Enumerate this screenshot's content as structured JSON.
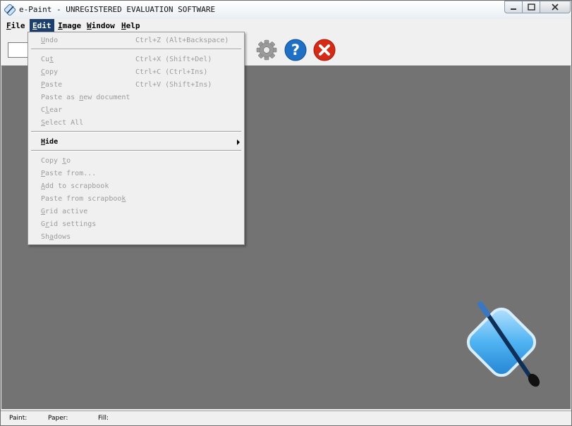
{
  "window": {
    "title": "e-Paint - UNREGISTERED EVALUATION SOFTWARE"
  },
  "menubar": {
    "items": [
      {
        "label": "File",
        "accel": "F",
        "rest": "ile"
      },
      {
        "label": "Edit",
        "accel": "E",
        "rest": "dit"
      },
      {
        "label": "Image",
        "accel": "I",
        "rest": "mage"
      },
      {
        "label": "Window",
        "accel": "W",
        "rest": "indow"
      },
      {
        "label": "Help",
        "accel": "H",
        "rest": "elp"
      }
    ]
  },
  "edit_menu": {
    "undo": {
      "pre": "",
      "accel": "U",
      "post": "ndo",
      "shortcut": "Ctrl+Z (Alt+Backspace)"
    },
    "cut": {
      "pre": "Cu",
      "accel": "t",
      "post": "",
      "shortcut": "Ctrl+X (Shift+Del)"
    },
    "copy": {
      "pre": "",
      "accel": "C",
      "post": "opy",
      "shortcut": "Ctrl+C (Ctrl+Ins)"
    },
    "paste": {
      "pre": "",
      "accel": "P",
      "post": "aste",
      "shortcut": "Ctrl+V (Shift+Ins)"
    },
    "paste_new": {
      "pre": "Paste as ",
      "accel": "n",
      "post": "ew document"
    },
    "clear": {
      "pre": "C",
      "accel": "l",
      "post": "ear"
    },
    "select_all": {
      "pre": "",
      "accel": "S",
      "post": "elect All"
    },
    "hide": {
      "pre": "",
      "accel": "H",
      "post": "ide"
    },
    "copy_to": {
      "pre": "Copy ",
      "accel": "t",
      "post": "o"
    },
    "paste_from": {
      "pre": "",
      "accel": "P",
      "post": "aste from..."
    },
    "add_scrapbook": {
      "pre": "",
      "accel": "A",
      "post": "dd to scrapbook"
    },
    "paste_scrapbook": {
      "pre": "Paste from scrapboo",
      "accel": "k",
      "post": ""
    },
    "grid_active": {
      "pre": "",
      "accel": "G",
      "post": "rid active"
    },
    "grid_settings": {
      "pre": "G",
      "accel": "r",
      "post": "id settings"
    },
    "shadows": {
      "pre": "Sh",
      "accel": "a",
      "post": "dows"
    }
  },
  "toolbar": {
    "icons": [
      "gear-icon",
      "help-icon",
      "close-icon"
    ]
  },
  "status": {
    "paint": "Paint:",
    "paper": "Paper:",
    "fill": "Fill:"
  },
  "colors": {
    "accent": "#1c3f6e",
    "canvas": "#737373",
    "help": "#1f6fc4",
    "close": "#d42a16"
  }
}
